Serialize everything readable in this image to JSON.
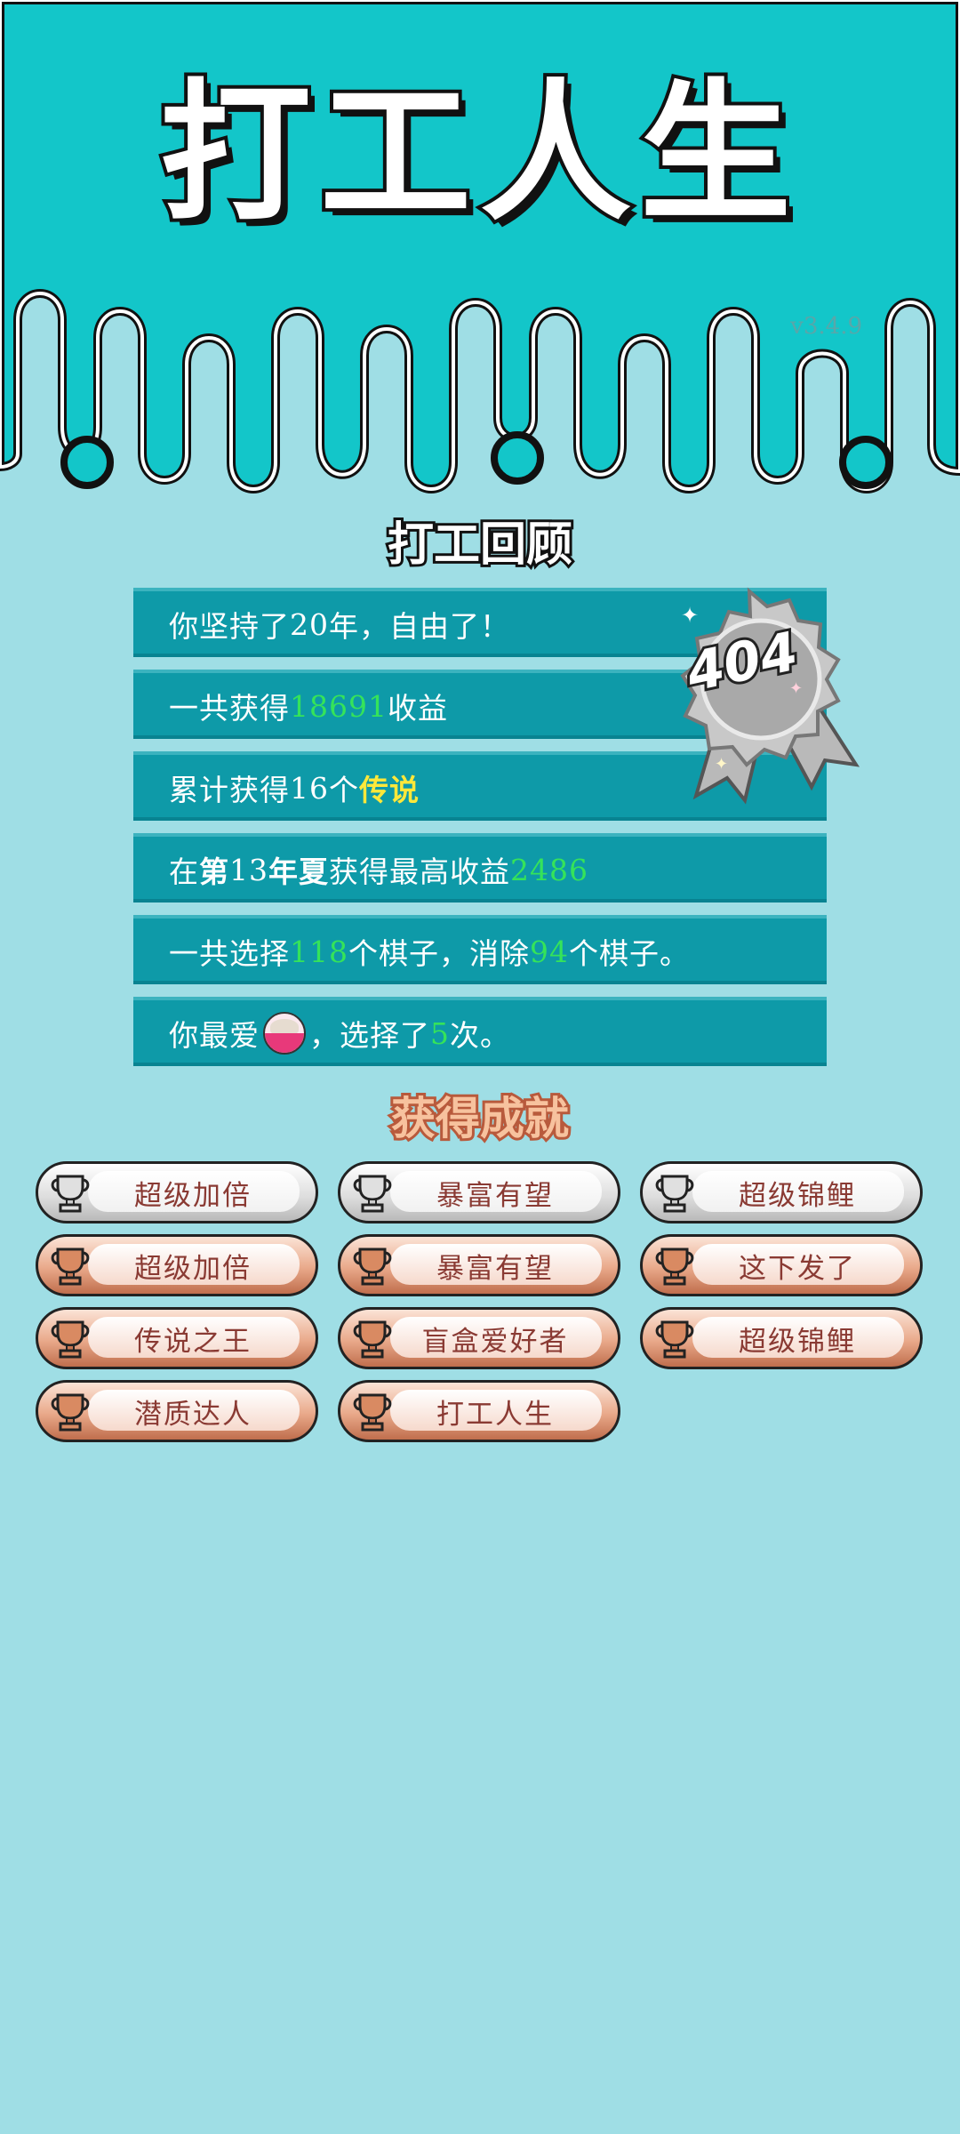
{
  "header": {
    "title": "打工人生",
    "version": "v3.4.9"
  },
  "review": {
    "title": "打工回顾",
    "badge": "404",
    "rows": [
      {
        "pre": "你坚持了",
        "num": "20",
        "post": "年，自由了！"
      },
      {
        "pre": "一共获得",
        "num": "18691",
        "post": "收益"
      },
      {
        "pre": "累计获得",
        "num": "16",
        "mid": "个",
        "hl": "传说"
      },
      {
        "pre": "在 ",
        "b1": "第",
        "num1": "13",
        "b2": "年夏",
        "mid": " 获得最高收益",
        "num": "2486"
      },
      {
        "pre": "一共选择",
        "num": "118",
        "mid": "个棋子，消除",
        "num2": "94",
        "post": "个棋子。"
      },
      {
        "pre": "你最爱",
        "post1": "，选择了",
        "num": "5",
        "post": "次。",
        "icon": "rice-bowl-icon"
      }
    ]
  },
  "achievements": {
    "title": "获得成就",
    "items": [
      {
        "label": "超级加倍",
        "tier": "silver"
      },
      {
        "label": "暴富有望",
        "tier": "silver"
      },
      {
        "label": "超级锦鲤",
        "tier": "silver"
      },
      {
        "label": "超级加倍",
        "tier": "bronze"
      },
      {
        "label": "暴富有望",
        "tier": "bronze"
      },
      {
        "label": "这下发了",
        "tier": "bronze"
      },
      {
        "label": "传说之王",
        "tier": "bronze"
      },
      {
        "label": "盲盒爱好者",
        "tier": "bronze"
      },
      {
        "label": "超级锦鲤",
        "tier": "bronze"
      },
      {
        "label": "潜质达人",
        "tier": "bronze"
      },
      {
        "label": "打工人生",
        "tier": "bronze"
      }
    ]
  },
  "colors": {
    "background": "#9fdee5",
    "header": "#13c6c9",
    "row": "#0e9aa8",
    "green": "#35e35a",
    "yellow": "#ffe83a"
  }
}
